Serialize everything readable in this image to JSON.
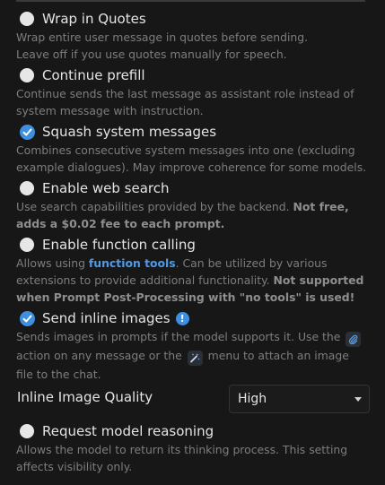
{
  "options": [
    {
      "label": "Wrap in Quotes",
      "checked": false,
      "desc_line1": "Wrap entire user message in quotes before sending.",
      "desc_line2": "Leave off if you use quotes manually for speech."
    },
    {
      "label": "Continue prefill",
      "checked": false,
      "desc_line1": "Continue sends the last message as assistant role instead of",
      "desc_line2": "system message with instruction."
    },
    {
      "label": "Squash system messages",
      "checked": true,
      "desc_line1": "Combines consecutive system messages into one (excluding",
      "desc_line2": "example dialogues). May improve coherence for some models."
    },
    {
      "label": "Enable web search",
      "checked": false,
      "desc_line1_a": "Use search capabilities provided by the backend. ",
      "desc_line1_b": "Not free,",
      "desc_line2": "adds a $0.02 fee to each prompt."
    },
    {
      "label": "Enable function calling",
      "checked": false,
      "desc_line1_a": "Allows using ",
      "desc_line1_link": "function tools",
      "desc_line1_b": ". Can be utilized by various",
      "desc_line2_a": "extensions to provide additional functionality. ",
      "desc_line2_b": "Not supported",
      "desc_line3": "when Prompt Post-Processing with \"no tools\" is used!"
    },
    {
      "label": "Send inline images",
      "checked": true,
      "info_glyph": "!",
      "desc_line1_a": "Sends images in prompts if the model supports it. Use the",
      "desc_line2_a": "action on any message or the",
      "desc_line2_b": "menu to attach an image",
      "desc_line3": "file to the chat."
    },
    {
      "label": "Request model reasoning",
      "checked": false,
      "desc_line1": "Allows the model to return its thinking process. This setting",
      "desc_line2": "affects visibility only."
    }
  ],
  "inline_quality": {
    "label": "Inline Image Quality",
    "value": "High"
  },
  "colors": {
    "accent": "#3f8fe0",
    "background": "#171717",
    "muted_text": "#7d7d7d"
  },
  "icons": [
    "paperclip-icon",
    "magic-wand-icon",
    "chevron-down-icon",
    "info-icon",
    "checkmark-icon"
  ]
}
